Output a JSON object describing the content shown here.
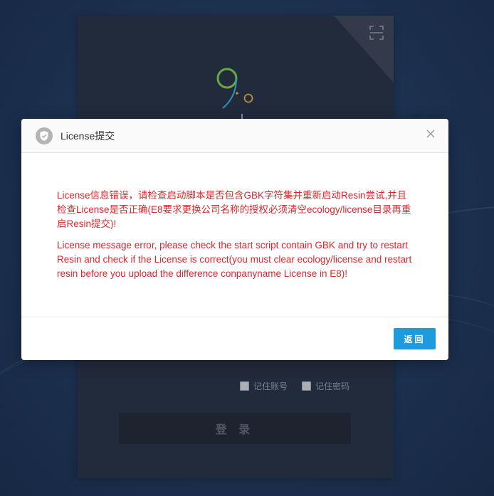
{
  "login": {
    "remember_account": "记住账号",
    "remember_password": "记住密码",
    "login_button": "登 录"
  },
  "modal": {
    "title": "License提交",
    "message_cn": "License信息错误，请检查启动脚本是否包含GBK字符集并重新启动Resin尝试,并且检查License是否正确(E8要求更换公司名称的授权必须清空ecology/license目录再重启Resin提交)!",
    "message_en": "License message error, please check the start script contain GBK and try to restart Resin and check if the License is correct(you must clear ecology/license and restart resin before you upload the difference conpanyname License in E8)!",
    "return_button": "返回"
  },
  "colors": {
    "error_text": "#d9292b",
    "primary_button": "#1d9bdc",
    "panel_bg": "#273142"
  },
  "icons": {
    "modal_icon": "shield-check-icon",
    "close": "close-icon",
    "qr": "scan-qr-icon",
    "logo": "e9-logo"
  }
}
